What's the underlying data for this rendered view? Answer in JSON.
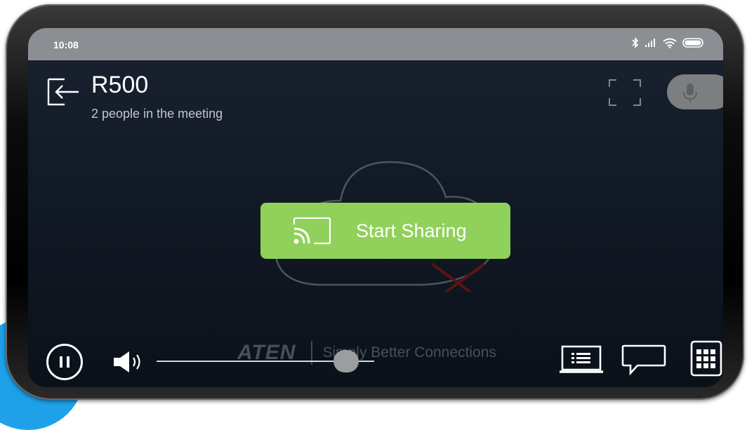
{
  "status_bar": {
    "time": "10:08",
    "icons": [
      "bluetooth-icon",
      "signal-icon",
      "wifi-icon",
      "battery-icon"
    ]
  },
  "meeting": {
    "room_name": "R500",
    "participants_text": "2 people in the meeting"
  },
  "share": {
    "label": "Start Sharing",
    "color": "#8fd15a",
    "icon": "cast-icon"
  },
  "watermark": {
    "brand": "ATEN",
    "tagline": "Simply Better Connections"
  },
  "controls": {
    "volume_level": 0.87,
    "icons": [
      "pause-icon",
      "volume-icon",
      "participants-icon",
      "chat-icon",
      "keypad-icon"
    ]
  },
  "colors": {
    "accent_blue": "#1ea1e8",
    "statusbar": "#8b8f94",
    "screen_bg": "#121a26"
  }
}
